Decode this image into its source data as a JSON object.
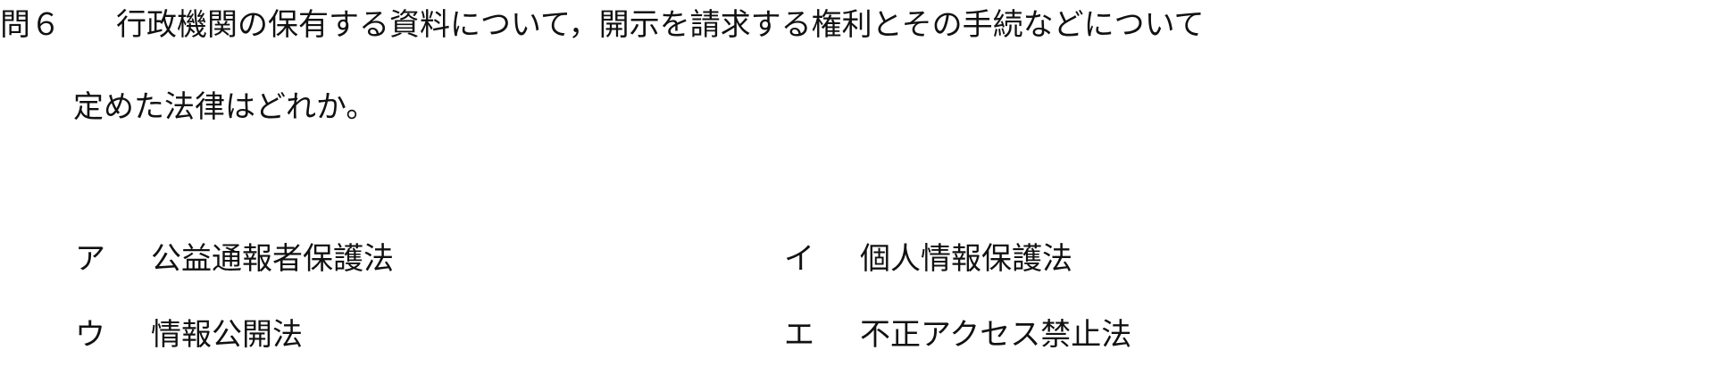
{
  "question": {
    "number": "問６",
    "text_line1": "行政機関の保有する資料について，開示を請求する権利とその手続などについて",
    "text_line2": "定めた法律はどれか。"
  },
  "choices": [
    {
      "marker": "ア",
      "text": "公益通報者保護法"
    },
    {
      "marker": "イ",
      "text": "個人情報保護法"
    },
    {
      "marker": "ウ",
      "text": "情報公開法"
    },
    {
      "marker": "エ",
      "text": "不正アクセス禁止法"
    }
  ]
}
